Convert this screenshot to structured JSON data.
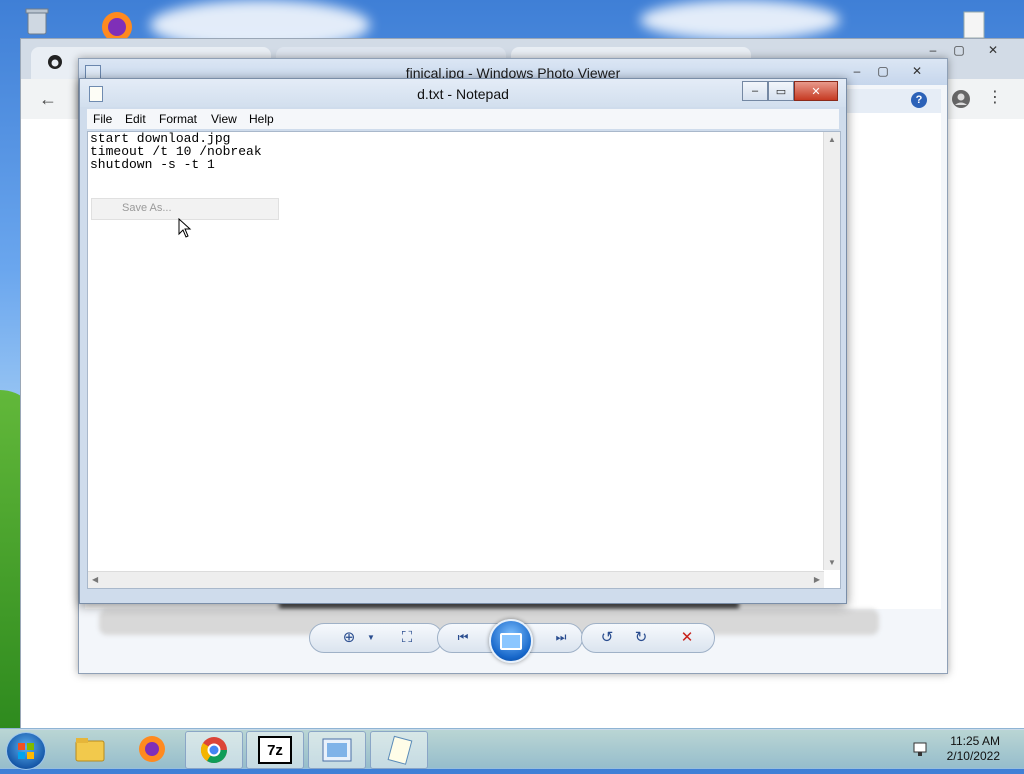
{
  "photo_viewer": {
    "title": "finical.jpg - Windows Photo Viewer",
    "toolbar": {
      "zoom": "zoom-icon",
      "fit": "fit-window-icon",
      "previous": "previous-icon",
      "slideshow": "slideshow-icon",
      "next": "next-icon",
      "rotate_ccw": "rotate-left-icon",
      "rotate_cw": "rotate-right-icon",
      "delete": "delete-icon"
    }
  },
  "notepad": {
    "title": "d.txt - Notepad",
    "menu": [
      "File",
      "Edit",
      "Format",
      "View",
      "Help"
    ],
    "content_lines": [
      "start download.jpg",
      "timeout /t 10 /nobreak",
      "shutdown -s -t 1"
    ],
    "popup_item": "Save As..."
  },
  "taskbar": {
    "apps": [
      "file-explorer",
      "firefox",
      "chrome",
      "7zip",
      "photo-viewer",
      "notepad"
    ],
    "sevenzip_label": "7z",
    "time": "11:25 AM",
    "date": "2/10/2022"
  },
  "colors": {
    "accent": "#1565c8",
    "close_red": "#c63a22"
  }
}
